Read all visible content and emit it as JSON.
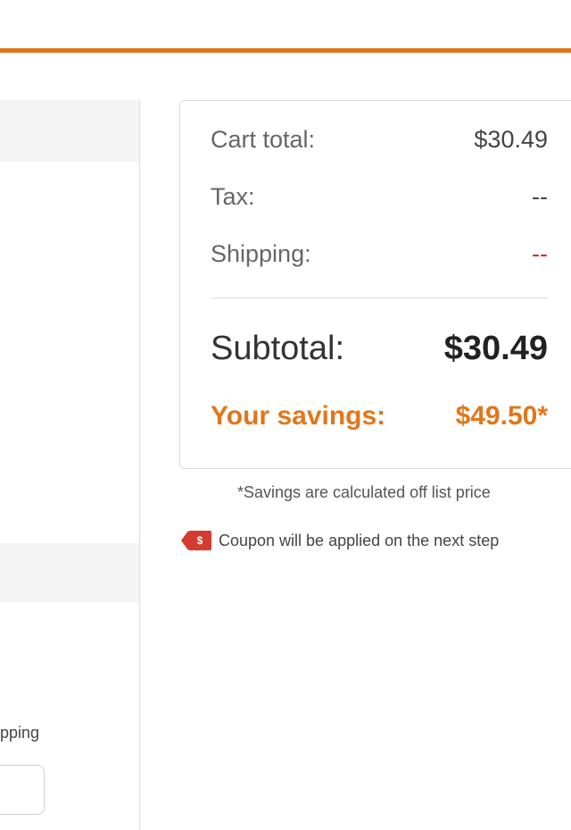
{
  "summary": {
    "cart_total_label": "Cart total:",
    "cart_total_value": "$30.49",
    "tax_label": "Tax:",
    "tax_value": "--",
    "shipping_label": "Shipping:",
    "shipping_value": "--",
    "subtotal_label": "Subtotal:",
    "subtotal_value": "$30.49",
    "savings_label": "Your savings:",
    "savings_value": "$49.50*"
  },
  "savings_note": "*Savings are calculated off list price",
  "coupon": {
    "icon_symbol": "$",
    "text": "Coupon will be applied on the next step"
  },
  "left_panel": {
    "shipping_fragment": "pping"
  },
  "colors": {
    "accent": "#e3761b",
    "coupon_tag": "#d63b2f",
    "shipping_dash": "#c0392b"
  }
}
